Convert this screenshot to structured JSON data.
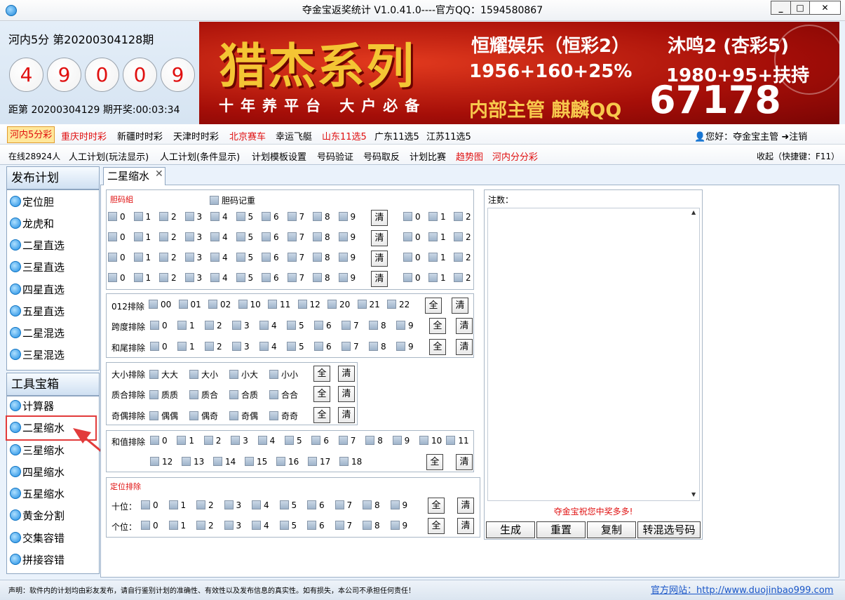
{
  "window": {
    "title": "夺金宝返奖统计  V1.0.41.0----官方QQ：1594580867",
    "min": "_",
    "max": "□",
    "close": "✕"
  },
  "draw": {
    "period": "河内5分  第20200304128期",
    "balls": [
      "4",
      "9",
      "0",
      "0",
      "9"
    ],
    "next": "距第 20200304129 期开奖:00:03:34"
  },
  "banner": {
    "main": "猎杰系列",
    "sub": "十年养平台 大户必备",
    "l1": "恒耀娱乐（恒彩2）",
    "l2": "1956+160+25%",
    "l3": "内部主管 麒麟QQ",
    "r1": "沐鸣2 (杏彩5)",
    "r2": "1980+95+扶持",
    "r3": "67178"
  },
  "lotteries": [
    "河内5分彩",
    "重庆时时彩",
    "新疆时时彩",
    "天津时时彩",
    "北京赛车",
    "幸运飞艇",
    "山东11选5",
    "广东11选5",
    "江苏11选5"
  ],
  "lottery_colors": {
    "active": "#e01010",
    "red": "#e01010",
    "normal": "#000000"
  },
  "user": "👤您好：夺金宝主管  ➜注销",
  "online": "在线28924人",
  "nav": [
    "人工计划(玩法显示)",
    "人工计划(条件显示)",
    "计划模板设置",
    "号码验证",
    "号码取反",
    "计划比赛",
    "趋势图",
    "河内分分彩"
  ],
  "collapse": "收起（快捷键：F11）",
  "sidebar": {
    "plan_title": "发布计划",
    "plan_items": [
      "定位胆",
      "龙虎和",
      "二星直选",
      "三星直选",
      "四星直选",
      "五星直选",
      "二星混选",
      "三星混选"
    ],
    "tool_title": "工具宝箱",
    "tool_items": [
      "计算器",
      "二星缩水",
      "三星缩水",
      "四星缩水",
      "五星缩水",
      "黄金分割",
      "交集容错",
      "拼接容错"
    ]
  },
  "tab": {
    "label": "二星缩水",
    "close": "✕"
  },
  "dan": {
    "title": "胆码組",
    "record": "胆码记重",
    "digits": [
      "0",
      "1",
      "2",
      "3",
      "4",
      "5",
      "6",
      "7",
      "8",
      "9"
    ],
    "extra": [
      "0",
      "1",
      "2"
    ],
    "clear": "清"
  },
  "ex012": {
    "label": "012排除",
    "items": [
      "00",
      "01",
      "02",
      "10",
      "11",
      "12",
      "20",
      "21",
      "22"
    ]
  },
  "span": {
    "label": "跨度排除",
    "items": [
      "0",
      "1",
      "2",
      "3",
      "4",
      "5",
      "6",
      "7",
      "8",
      "9"
    ]
  },
  "tail": {
    "label": "和尾排除",
    "items": [
      "0",
      "1",
      "2",
      "3",
      "4",
      "5",
      "6",
      "7",
      "8",
      "9"
    ]
  },
  "size": {
    "label": "大小排除",
    "items": [
      "大大",
      "大小",
      "小大",
      "小小"
    ]
  },
  "prime": {
    "label": "质合排除",
    "items": [
      "质质",
      "质合",
      "合质",
      "合合"
    ]
  },
  "odd": {
    "label": "奇偶排除",
    "items": [
      "偶偶",
      "偶奇",
      "奇偶",
      "奇奇"
    ]
  },
  "sum": {
    "label": "和值排除",
    "row1": [
      "0",
      "1",
      "2",
      "3",
      "4",
      "5",
      "6",
      "7",
      "8",
      "9",
      "10",
      "11"
    ],
    "row2": [
      "12",
      "13",
      "14",
      "15",
      "16",
      "17",
      "18"
    ]
  },
  "pos": {
    "title": "定位排除",
    "ten": "十位：",
    "one": "个位：",
    "items": [
      "0",
      "1",
      "2",
      "3",
      "4",
      "5",
      "6",
      "7",
      "8",
      "9"
    ]
  },
  "btn": {
    "all": "全",
    "clear": "清"
  },
  "note": {
    "label": "注数：",
    "wish": "夺金宝祝您中奖多多!",
    "up": "▲",
    "down": "▼"
  },
  "actions": [
    "生成",
    "重置",
    "复制",
    "转混选号码"
  ],
  "footer": {
    "disclaimer": "声明：软件内的计划均由彩友发布，请自行鉴别计划的准确性、有效性以及发布信息的真实性。如有损失，本公司不承担任何责任！",
    "site": "官方网站：http://www.duojinbao999.com"
  }
}
